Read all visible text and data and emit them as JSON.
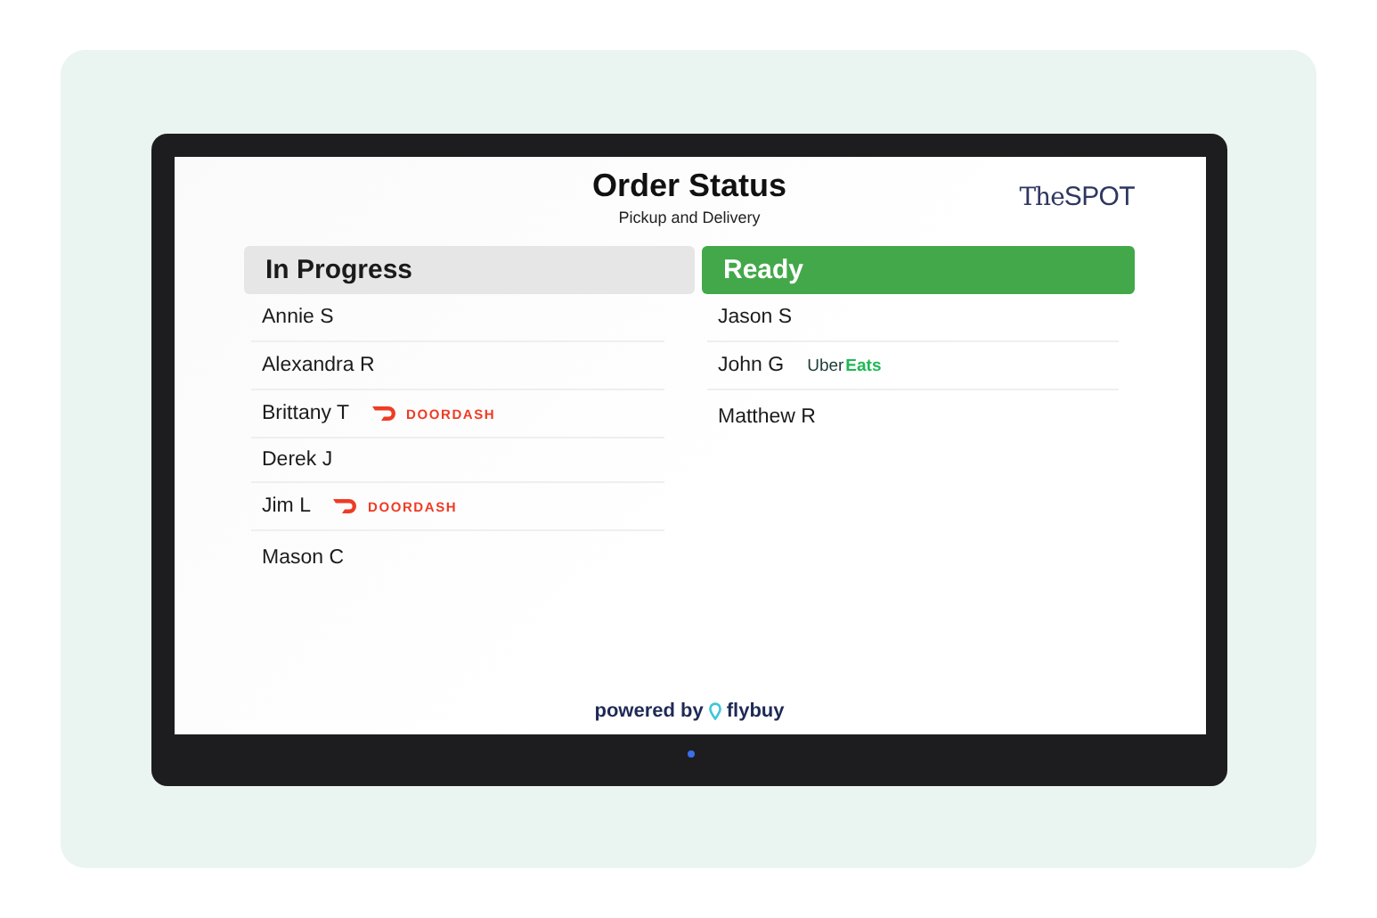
{
  "header": {
    "title": "Order Status",
    "subtitle": "Pickup and Delivery",
    "logo": {
      "part_1": "The",
      "part_2": "SPOT"
    }
  },
  "columns": [
    {
      "title": "In Progress",
      "kind": "progress",
      "orders": [
        {
          "name": "Annie S"
        },
        {
          "name": "Alexandra R"
        },
        {
          "name": "Brittany T",
          "service": {
            "kind": "doordash",
            "label": "DOORDASH"
          }
        },
        {
          "name": "Derek J"
        },
        {
          "name": "Jim L",
          "service": {
            "kind": "doordash",
            "label": "DOORDASH"
          }
        },
        {
          "name": "Mason C"
        }
      ]
    },
    {
      "title": "Ready",
      "kind": "ready",
      "orders": [
        {
          "name": "Jason S"
        },
        {
          "name": "John G",
          "service": {
            "kind": "ubereats",
            "label": "Uber",
            "label_2": "Eats"
          }
        },
        {
          "name": "Matthew R"
        }
      ]
    }
  ],
  "footer": {
    "text": "powered by",
    "brand": "flybuy"
  }
}
